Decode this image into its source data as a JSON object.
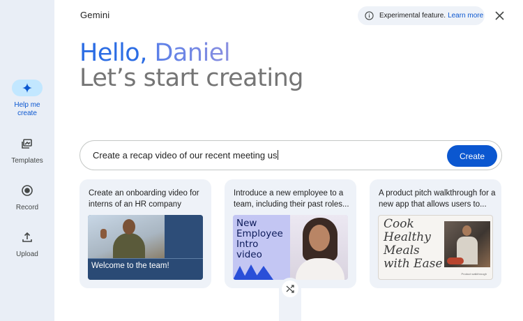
{
  "app": {
    "title": "Gemini"
  },
  "notice": {
    "text": "Experimental feature.",
    "link": "Learn more"
  },
  "rail": {
    "items": [
      {
        "label": "Help me create",
        "icon": "sparkle-icon",
        "active": true
      },
      {
        "label": "Templates",
        "icon": "templates-icon",
        "active": false
      },
      {
        "label": "Record",
        "icon": "record-icon",
        "active": false
      },
      {
        "label": "Upload",
        "icon": "upload-icon",
        "active": false
      }
    ]
  },
  "greeting": {
    "hello": "Hello,",
    "name": "Daniel",
    "subtitle": "Let’s start creating"
  },
  "prompt": {
    "value": "Create a recap video of our recent meeting us",
    "button": "Create"
  },
  "cards": [
    {
      "text": "Create an onboarding video for interns of an HR company",
      "thumb_text": "Welcome to the team!"
    },
    {
      "text": "Introduce a new employee to a team, including their past roles...",
      "thumb_text": "New Employee Intro video"
    },
    {
      "text": "A product pitch walkthrough for a new app that allows users to...",
      "thumb_text": "Cook Healthy Meals with Ease",
      "thumb_caption": "Product walkthrough"
    }
  ],
  "colors": {
    "accent": "#0b57d0",
    "rail_bg": "#e9eef6",
    "card_bg": "#eef2f8"
  }
}
